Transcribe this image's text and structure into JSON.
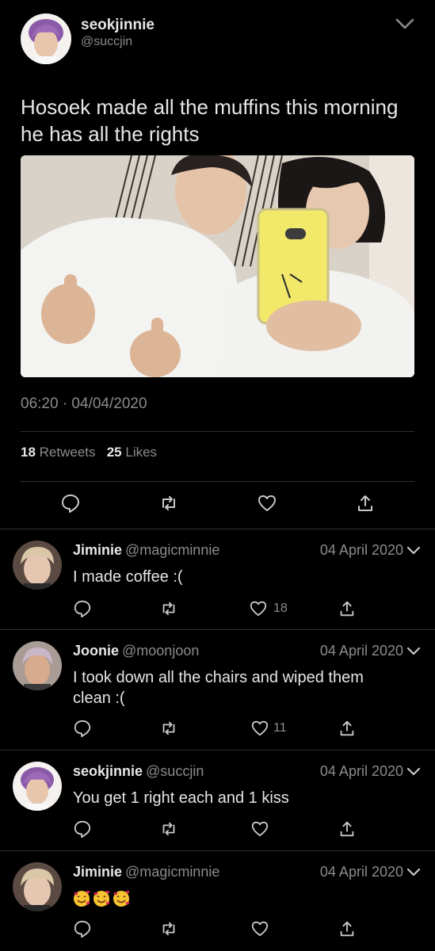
{
  "main_tweet": {
    "display_name": "seokjinnie",
    "handle": "@succjin",
    "text": "Hosoek made all the muffins this morning he has all the rights",
    "timestamp": "06:20 · 04/04/2020",
    "retweets_count": "18",
    "retweets_label": "Retweets",
    "likes_count": "25",
    "likes_label": "Likes"
  },
  "replies": [
    {
      "display_name": "Jiminie",
      "handle": "@magicminnie",
      "date": "04 April 2020",
      "text": "I made coffee :(",
      "likes": "18"
    },
    {
      "display_name": "Joonie",
      "handle": "@moonjoon",
      "date": "04 April 2020",
      "text": "I took down all the chairs and wiped them clean :(",
      "likes": "11"
    },
    {
      "display_name": "seokjinnie",
      "handle": "@succjin",
      "date": "04 April 2020",
      "text": "You get 1 right each and 1 kiss",
      "likes": ""
    },
    {
      "display_name": "Jiminie",
      "handle": "@magicminnie",
      "date": "04 April 2020",
      "text": "",
      "likes": ""
    }
  ],
  "colors": {
    "background": "#000000",
    "text_primary": "#e6e6e6",
    "text_secondary": "#8b8b8b",
    "divider": "#2f2f2f"
  },
  "icons": [
    "chevron-down-icon",
    "reply-icon",
    "retweet-icon",
    "like-icon",
    "share-icon",
    "smiling-face-with-hearts-emoji"
  ]
}
